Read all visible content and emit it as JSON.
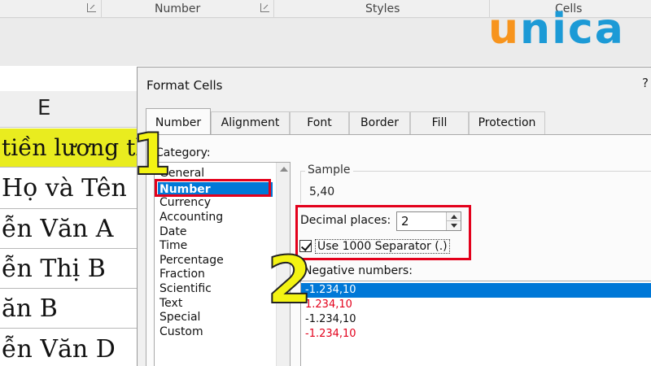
{
  "ribbon": {
    "group_number": "Number",
    "group_styles": "Styles",
    "group_cells": "Cells"
  },
  "sheet": {
    "column_header": "E",
    "cells": [
      "tiền lương th",
      "Họ và Tên",
      "ễn Văn A",
      "ễn Thị B",
      "ăn B",
      "ễn Văn D"
    ],
    "highlight_color": "#e9ec1f"
  },
  "dialog": {
    "title": "Format Cells",
    "help": "?",
    "tabs": [
      "Number",
      "Alignment",
      "Font",
      "Border",
      "Fill",
      "Protection"
    ],
    "category_label": "Category:",
    "categories": [
      "General",
      "Number",
      "Currency",
      "Accounting",
      "Date",
      "Time",
      "Percentage",
      "Fraction",
      "Scientific",
      "Text",
      "Special",
      "Custom"
    ],
    "selected_category": "Number",
    "sample_label": "Sample",
    "sample_value": "5,40",
    "decimal_label": "Decimal places:",
    "decimal_value": "2",
    "separator_label": "Use 1000 Separator (.)",
    "separator_checked": true,
    "negative_label": "Negative numbers:",
    "negative_options": [
      {
        "text": "-1.234,10",
        "color": "#ffffff",
        "selected": true
      },
      {
        "text": "1.234,10",
        "color": "#e3001b"
      },
      {
        "text": "-1.234,10",
        "color": "#111111"
      },
      {
        "text": "-1.234,10",
        "color": "#e3001b"
      }
    ]
  },
  "annotations": {
    "step1": "1",
    "step2": "2",
    "highlight_color": "#e3001b",
    "step_color": "#f3f313"
  },
  "logo": {
    "letters": [
      "u",
      "n",
      "i",
      "c",
      "a"
    ],
    "colors": [
      "#f7941d",
      "#1c9ad6",
      "#1c9ad6",
      "#1c9ad6",
      "#1c9ad6"
    ]
  }
}
